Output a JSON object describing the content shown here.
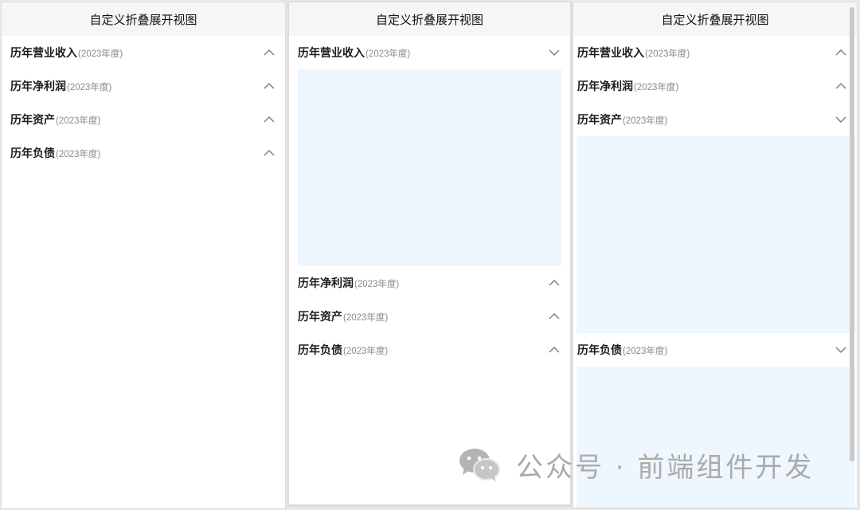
{
  "panels": [
    {
      "title": "自定义折叠展开视图",
      "sections": [
        {
          "title": "历年营业收入",
          "sub": "(2023年度)",
          "expanded": false
        },
        {
          "title": "历年净利润",
          "sub": "(2023年度)",
          "expanded": false
        },
        {
          "title": "历年资产",
          "sub": "(2023年度)",
          "expanded": false
        },
        {
          "title": "历年负债",
          "sub": "(2023年度)",
          "expanded": false
        }
      ]
    },
    {
      "title": "自定义折叠展开视图",
      "sections": [
        {
          "title": "历年营业收入",
          "sub": "(2023年度)",
          "expanded": true
        },
        {
          "title": "历年净利润",
          "sub": "(2023年度)",
          "expanded": false
        },
        {
          "title": "历年资产",
          "sub": "(2023年度)",
          "expanded": false
        },
        {
          "title": "历年负债",
          "sub": "(2023年度)",
          "expanded": false
        }
      ]
    },
    {
      "title": "自定义折叠展开视图",
      "sections": [
        {
          "title": "历年营业收入",
          "sub": "(2023年度)",
          "expanded": false
        },
        {
          "title": "历年净利润",
          "sub": "(2023年度)",
          "expanded": false
        },
        {
          "title": "历年资产",
          "sub": "(2023年度)",
          "expanded": true
        },
        {
          "title": "历年负债",
          "sub": "(2023年度)",
          "expanded": true
        }
      ]
    }
  ],
  "icons": {
    "collapsed": "chevron-up-icon",
    "expanded": "chevron-down-icon",
    "watermark": "wechat-icon"
  },
  "colors": {
    "expanded_body": "#eef6fe",
    "header_bg": "#f6f6f6",
    "chevron": "#7a7a7a",
    "watermark": "#ababab"
  },
  "watermark": {
    "text": "公众号 · 前端组件开发"
  }
}
